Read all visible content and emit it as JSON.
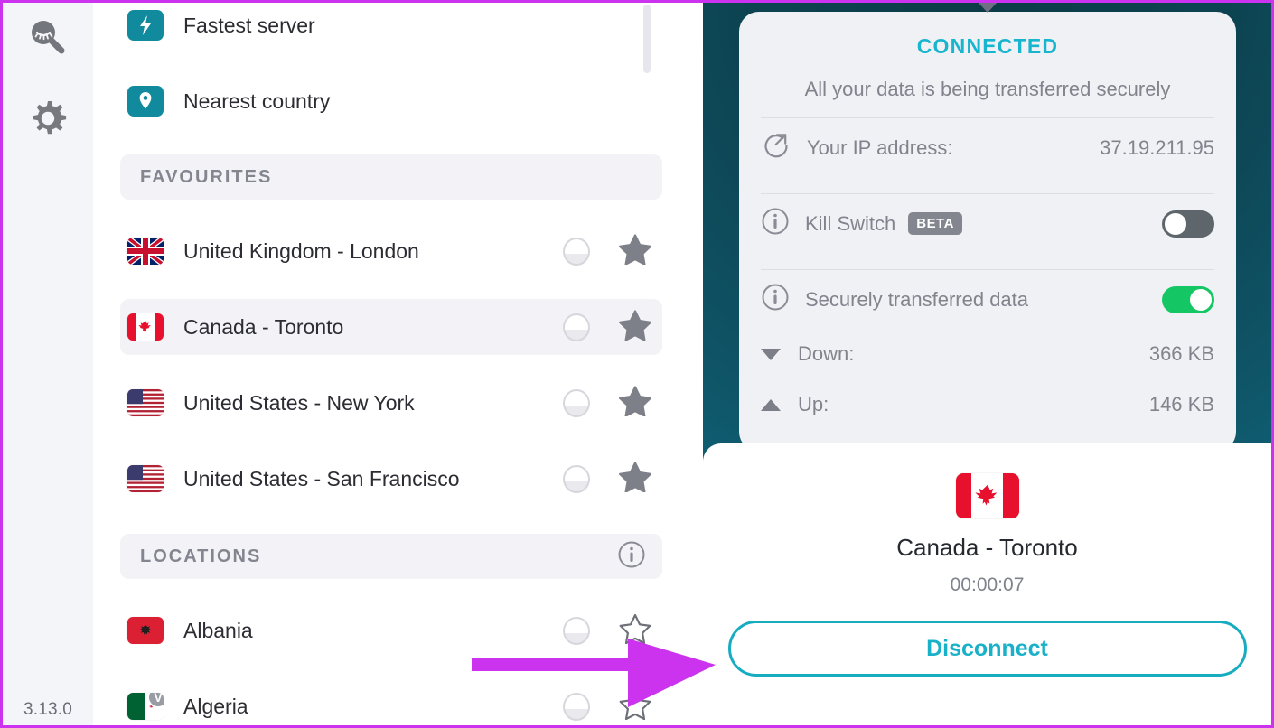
{
  "sidebar": {
    "icons": [
      {
        "name": "private-search-icon",
        "label": "Private search"
      },
      {
        "name": "gear-icon",
        "label": "Settings"
      }
    ],
    "version": "3.13.0"
  },
  "server_list": {
    "quick_items": [
      {
        "icon": "lightning-icon",
        "label": "Fastest server"
      },
      {
        "icon": "location-pin-icon",
        "label": "Nearest country"
      }
    ],
    "favourites_header": "FAVOURITES",
    "favourites": [
      {
        "flag": "gb",
        "label": "United Kingdom - London",
        "starred": true,
        "selected": false
      },
      {
        "flag": "ca",
        "label": "Canada - Toronto",
        "starred": true,
        "selected": true
      },
      {
        "flag": "us",
        "label": "United States - New York",
        "starred": true,
        "selected": false
      },
      {
        "flag": "us",
        "label": "United States - San Francisco",
        "starred": true,
        "selected": false
      }
    ],
    "locations_header": "LOCATIONS",
    "locations": [
      {
        "flag": "al",
        "label": "Albania",
        "starred": false,
        "badge": ""
      },
      {
        "flag": "dz",
        "label": "Algeria",
        "starred": false,
        "badge": "V"
      }
    ]
  },
  "vpn": {
    "status": "CONNECTED",
    "subtitle": "All your data is being transferred securely",
    "ip_label": "Your IP address:",
    "ip_value": "37.19.211.95",
    "kill_switch_label": "Kill Switch",
    "kill_switch_badge": "BETA",
    "kill_switch_on": false,
    "secure_data_label": "Securely transferred data",
    "secure_data_on": true,
    "down_label": "Down:",
    "down_value": "366 KB",
    "up_label": "Up:",
    "up_value": "146 KB",
    "connected_flag": "ca",
    "connected_location": "Canada - Toronto",
    "timer": "00:00:07",
    "disconnect_label": "Disconnect"
  },
  "colors": {
    "accent_teal": "#18b5ce",
    "button_teal": "#18acc0",
    "icon_teal": "#108a9c",
    "toggle_on_green": "#15c764",
    "toggle_off_gray": "#5e666b",
    "annotation_magenta": "#cc33ee",
    "panel_bg": "#f0f1f5",
    "rail_bg": "#f4f5f9"
  },
  "annotation": {
    "type": "arrow",
    "points_to": "disconnect-button"
  }
}
